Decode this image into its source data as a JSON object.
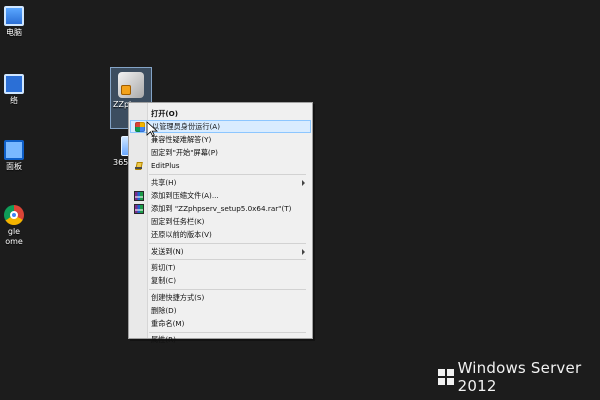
{
  "desktop": {
    "left_icons": [
      {
        "label": "电脑",
        "icon": "computer-icon"
      },
      {
        "label": "络",
        "icon": "network-icon"
      },
      {
        "label": "面板",
        "icon": "control-panel-icon"
      },
      {
        "label": "gle\nome",
        "icon": "chrome-icon"
      }
    ],
    "selected_icon": {
      "label": "ZZphpserv_setup",
      "icon": "installer-icon"
    },
    "small_icon": {
      "label": "365s",
      "icon": "app-icon"
    }
  },
  "context_menu": {
    "items": [
      {
        "label": "打开(O)",
        "bold": true,
        "icon": "",
        "submenu": false
      },
      {
        "label": "以管理员身份运行(A)",
        "bold": false,
        "icon": "shield-icon",
        "submenu": false,
        "hover": true
      },
      {
        "label": "兼容性疑难解答(Y)",
        "bold": false,
        "icon": "",
        "submenu": false
      },
      {
        "label": "固定到\"开始\"屏幕(P)",
        "bold": false,
        "icon": "",
        "submenu": false
      },
      {
        "label": "EditPlus",
        "bold": false,
        "icon": "editplus-icon",
        "submenu": false
      },
      {
        "label": "共享(H)",
        "bold": false,
        "icon": "",
        "submenu": true
      },
      {
        "label": "添加到压缩文件(A)...",
        "bold": false,
        "icon": "rar-icon",
        "submenu": false
      },
      {
        "label": "添加到 \"ZZphpserv_setup5.0x64.rar\"(T)",
        "bold": false,
        "icon": "rar-icon",
        "submenu": false
      },
      {
        "label": "固定到任务栏(K)",
        "bold": false,
        "icon": "",
        "submenu": false
      },
      {
        "label": "还原以前的版本(V)",
        "bold": false,
        "icon": "",
        "submenu": false
      },
      {
        "label": "发送到(N)",
        "bold": false,
        "icon": "",
        "submenu": true
      },
      {
        "label": "剪切(T)",
        "bold": false,
        "icon": "",
        "submenu": false
      },
      {
        "label": "复制(C)",
        "bold": false,
        "icon": "",
        "submenu": false
      },
      {
        "label": "创建快捷方式(S)",
        "bold": false,
        "icon": "",
        "submenu": false
      },
      {
        "label": "删除(D)",
        "bold": false,
        "icon": "",
        "submenu": false
      },
      {
        "label": "重命名(M)",
        "bold": false,
        "icon": "",
        "submenu": false
      },
      {
        "label": "属性(R)",
        "bold": false,
        "icon": "",
        "submenu": false
      }
    ]
  },
  "watermark": {
    "text": "Windows Server 2012"
  }
}
